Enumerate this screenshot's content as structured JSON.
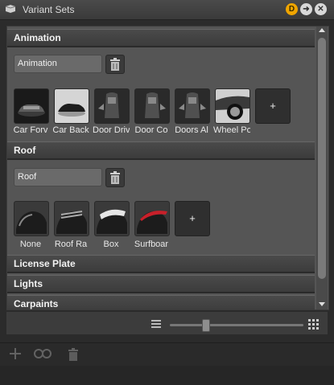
{
  "window": {
    "title": "Variant Sets",
    "badge_label": "D",
    "icons": [
      "app-icon",
      "arrow-right-icon",
      "close-icon"
    ]
  },
  "sections": [
    {
      "title": "Animation",
      "name_value": "Animation",
      "variants": [
        "Car Forv",
        "Car Back",
        "Door Driv",
        "Door Co",
        "Doors Al",
        "Wheel Po"
      ],
      "add_label": "+"
    },
    {
      "title": "Roof",
      "name_value": "Roof",
      "variants": [
        "None",
        "Roof Ra",
        "Box",
        "Surfboar"
      ],
      "add_label": "+"
    },
    {
      "title": "License Plate"
    },
    {
      "title": "Lights"
    },
    {
      "title": "Carpaints"
    }
  ],
  "zoom": {
    "level": 0.27,
    "icons": [
      "list-view-icon",
      "grid-view-icon"
    ]
  },
  "bottom_toolbar": {
    "icons": [
      "add-icon",
      "link-icon",
      "trash-icon"
    ]
  },
  "colors": {
    "badge": "#f0a500",
    "roof_accent": "#c8202a"
  }
}
